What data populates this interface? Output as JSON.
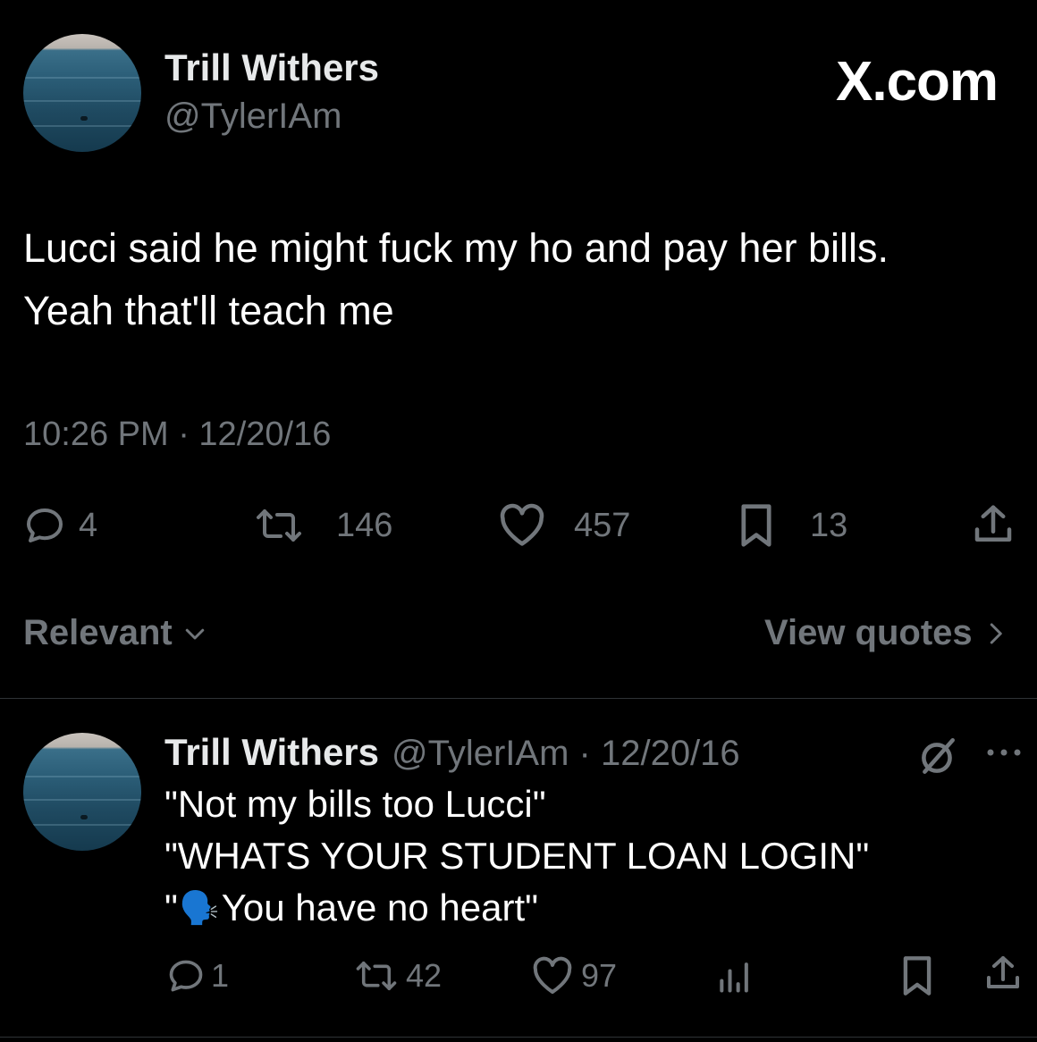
{
  "tweet": {
    "display_name": "Trill Withers",
    "handle": "@TylerIAm",
    "brand": "X.com",
    "text_line1": "Lucci said he might fuck my ho and pay her bills.",
    "text_line2": "Yeah that'll teach me",
    "timestamp": "10:26 PM · 12/20/16",
    "stats": {
      "replies": "4",
      "retweets": "146",
      "likes": "457",
      "bookmarks": "13"
    }
  },
  "controls": {
    "sort_label": "Relevant",
    "view_quotes_label": "View quotes"
  },
  "reply": {
    "display_name": "Trill Withers",
    "handle_date": "@TylerIAm · 12/20/16",
    "line1": "\"Not my bills too Lucci\"",
    "line2": "\"WHATS YOUR STUDENT LOAN LOGIN\"",
    "line3_prefix": "\"",
    "line3_emoji": "🗣️",
    "line3_text": "You have no heart\"",
    "stats": {
      "replies": "1",
      "retweets": "42",
      "likes": "97"
    }
  },
  "icons": {
    "reply": "reply-icon",
    "retweet": "retweet-icon",
    "like": "heart-icon",
    "bookmark": "bookmark-icon",
    "share": "share-icon",
    "views": "views-icon",
    "more": "more-icon",
    "grok": "grok-icon",
    "chevron_down": "chevron-down-icon",
    "chevron_right": "chevron-right-icon"
  },
  "colors": {
    "background": "#000000",
    "text": "#e7e9ea",
    "muted": "#71767b",
    "divider": "#2f3336"
  }
}
